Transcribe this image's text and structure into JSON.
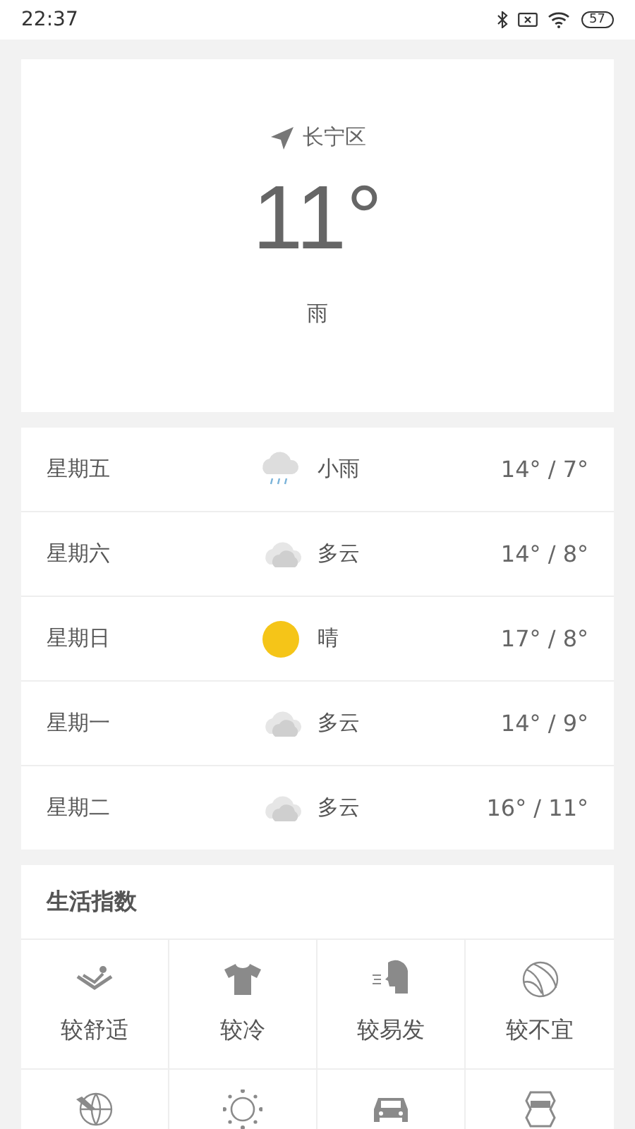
{
  "status_bar": {
    "time": "22:37",
    "battery": "57"
  },
  "current": {
    "location": "长宁区",
    "temperature": "11°",
    "condition": "雨"
  },
  "forecast": [
    {
      "day": "星期五",
      "kind": "rain",
      "condition": "小雨",
      "temps": "14° / 7°"
    },
    {
      "day": "星期六",
      "kind": "cloudy",
      "condition": "多云",
      "temps": "14° / 8°"
    },
    {
      "day": "星期日",
      "kind": "sun",
      "condition": "晴",
      "temps": "17° / 8°"
    },
    {
      "day": "星期一",
      "kind": "cloudy",
      "condition": "多云",
      "temps": "14° / 9°"
    },
    {
      "day": "星期二",
      "kind": "cloudy",
      "condition": "多云",
      "temps": "16° / 11°"
    }
  ],
  "life_index": {
    "title": "生活指数",
    "items": [
      {
        "kind": "comfort",
        "label": "较舒适"
      },
      {
        "kind": "shirt",
        "label": "较冷"
      },
      {
        "kind": "cold",
        "label": "较易发"
      },
      {
        "kind": "ball",
        "label": "较不宜"
      },
      {
        "kind": "globe"
      },
      {
        "kind": "uv"
      },
      {
        "kind": "car"
      },
      {
        "kind": "mask"
      }
    ]
  }
}
